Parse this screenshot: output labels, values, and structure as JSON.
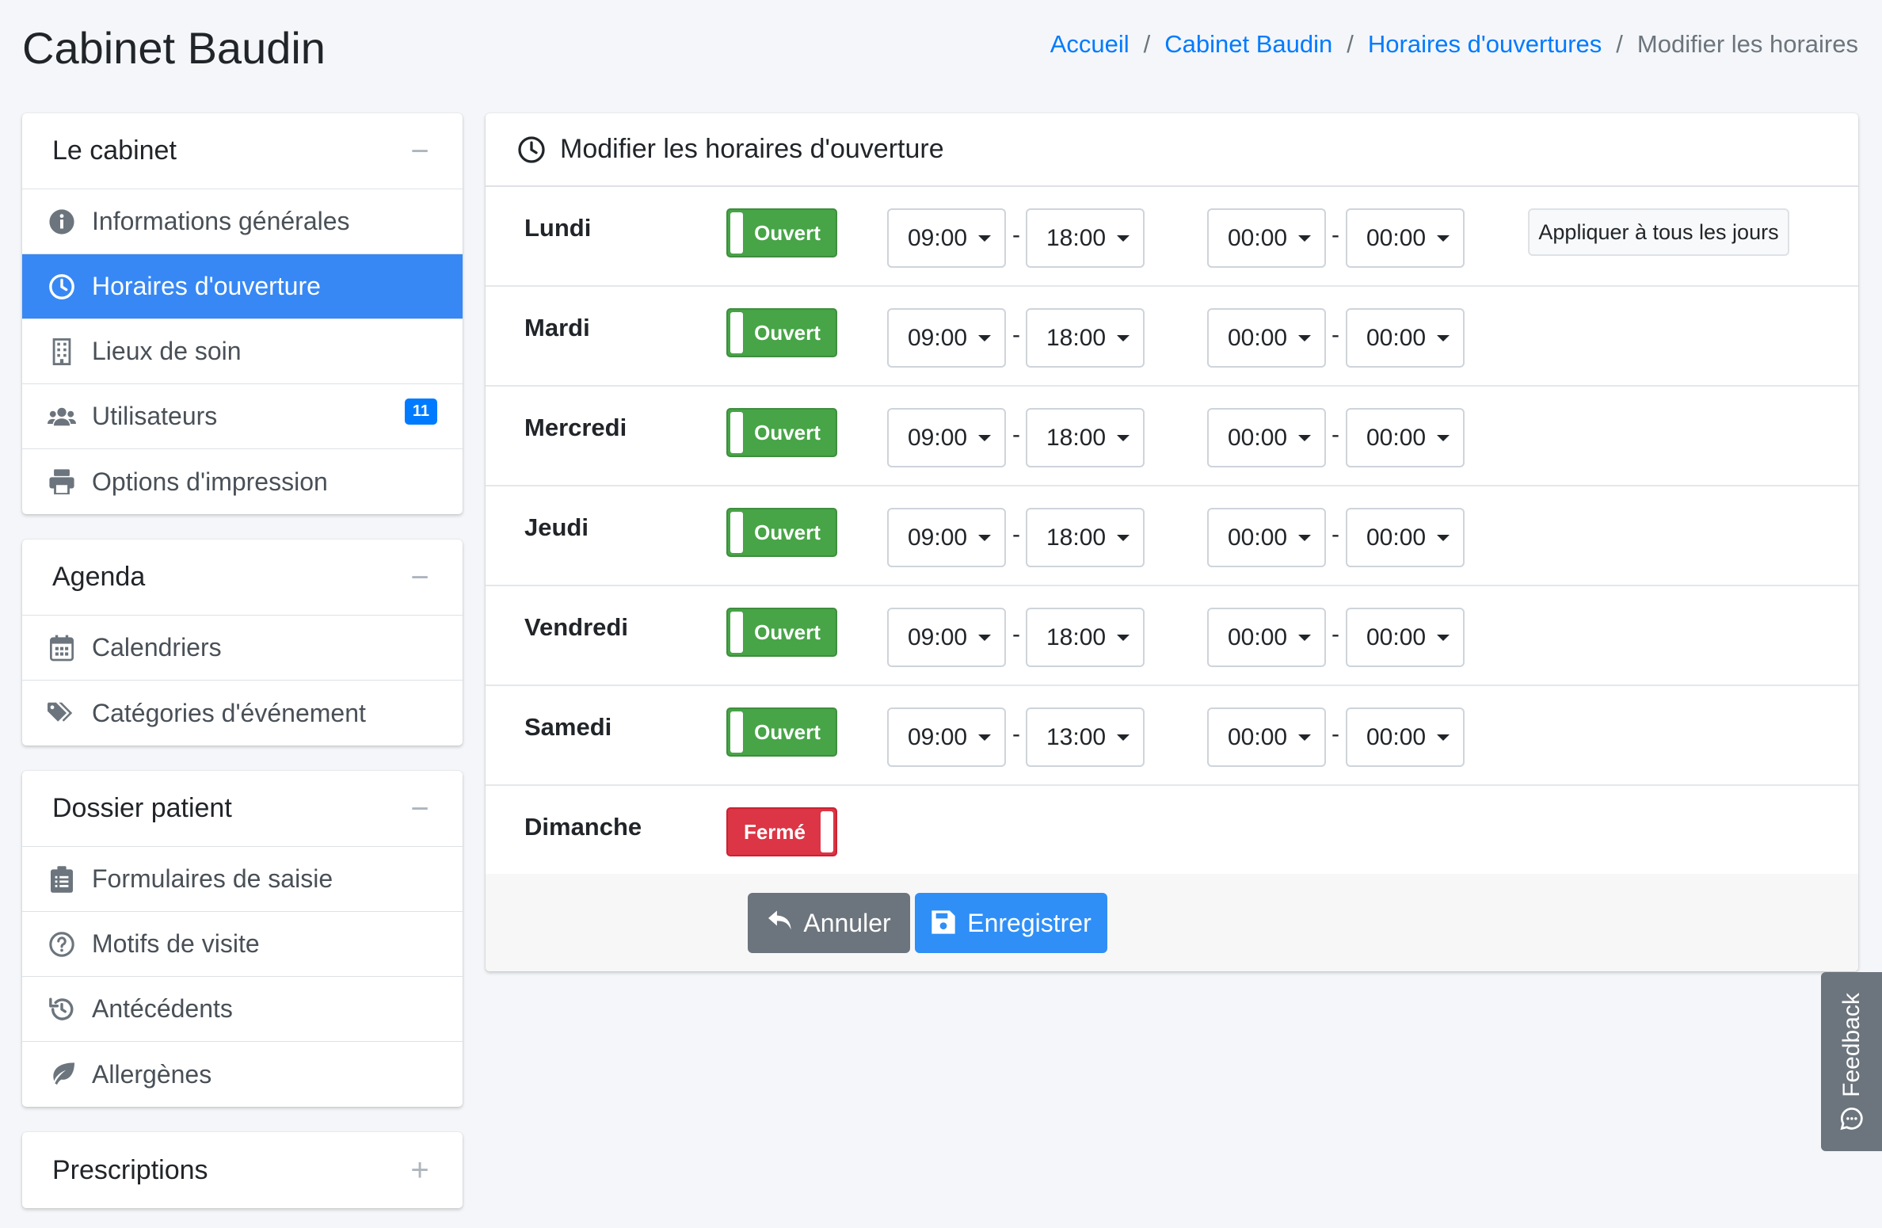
{
  "page": {
    "title": "Cabinet Baudin"
  },
  "breadcrumb": {
    "items": [
      "Accueil",
      "Cabinet Baudin",
      "Horaires d'ouvertures"
    ],
    "current": "Modifier les horaires",
    "separator": "/"
  },
  "sidebar": {
    "cabinet": {
      "title": "Le cabinet",
      "tool": "−",
      "items": [
        {
          "label": "Informations générales",
          "icon": "info-circle-icon"
        },
        {
          "label": "Horaires d'ouverture",
          "icon": "clock-icon",
          "active": true
        },
        {
          "label": "Lieux de soin",
          "icon": "building-icon"
        },
        {
          "label": "Utilisateurs",
          "icon": "users-icon",
          "badge": "11"
        },
        {
          "label": "Options d'impression",
          "icon": "printer-icon"
        }
      ]
    },
    "agenda": {
      "title": "Agenda",
      "tool": "−",
      "items": [
        {
          "label": "Calendriers",
          "icon": "calendar-icon"
        },
        {
          "label": "Catégories d'événement",
          "icon": "tags-icon"
        }
      ]
    },
    "dossier": {
      "title": "Dossier patient",
      "tool": "−",
      "items": [
        {
          "label": "Formulaires de saisie",
          "icon": "clipboard-list-icon"
        },
        {
          "label": "Motifs de visite",
          "icon": "question-circle-icon"
        },
        {
          "label": "Antécédents",
          "icon": "history-icon"
        },
        {
          "label": "Allergènes",
          "icon": "leaf-icon"
        }
      ]
    },
    "prescriptions": {
      "title": "Prescriptions",
      "tool": "+"
    }
  },
  "main": {
    "title": "Modifier les horaires d'ouverture",
    "apply_all_label": "Appliquer à tous les jours",
    "days": [
      {
        "name": "Lundi",
        "status": "Ouvert",
        "open": true,
        "times": [
          "09:00",
          "18:00",
          "00:00",
          "00:00"
        ]
      },
      {
        "name": "Mardi",
        "status": "Ouvert",
        "open": true,
        "times": [
          "09:00",
          "18:00",
          "00:00",
          "00:00"
        ]
      },
      {
        "name": "Mercredi",
        "status": "Ouvert",
        "open": true,
        "times": [
          "09:00",
          "18:00",
          "00:00",
          "00:00"
        ]
      },
      {
        "name": "Jeudi",
        "status": "Ouvert",
        "open": true,
        "times": [
          "09:00",
          "18:00",
          "00:00",
          "00:00"
        ]
      },
      {
        "name": "Vendredi",
        "status": "Ouvert",
        "open": true,
        "times": [
          "09:00",
          "18:00",
          "00:00",
          "00:00"
        ]
      },
      {
        "name": "Samedi",
        "status": "Ouvert",
        "open": true,
        "times": [
          "09:00",
          "13:00",
          "00:00",
          "00:00"
        ]
      },
      {
        "name": "Dimanche",
        "status": "Fermé",
        "open": false,
        "times": []
      }
    ],
    "time_separator": "-",
    "cancel_label": "Annuler",
    "save_label": "Enregistrer"
  },
  "feedback": {
    "label": "Feedback"
  },
  "colors": {
    "primary": "#007bff",
    "active_nav": "#3788f4",
    "open_green": "#47a447",
    "closed_red": "#dc3545",
    "cancel_gray": "#6c757d"
  }
}
